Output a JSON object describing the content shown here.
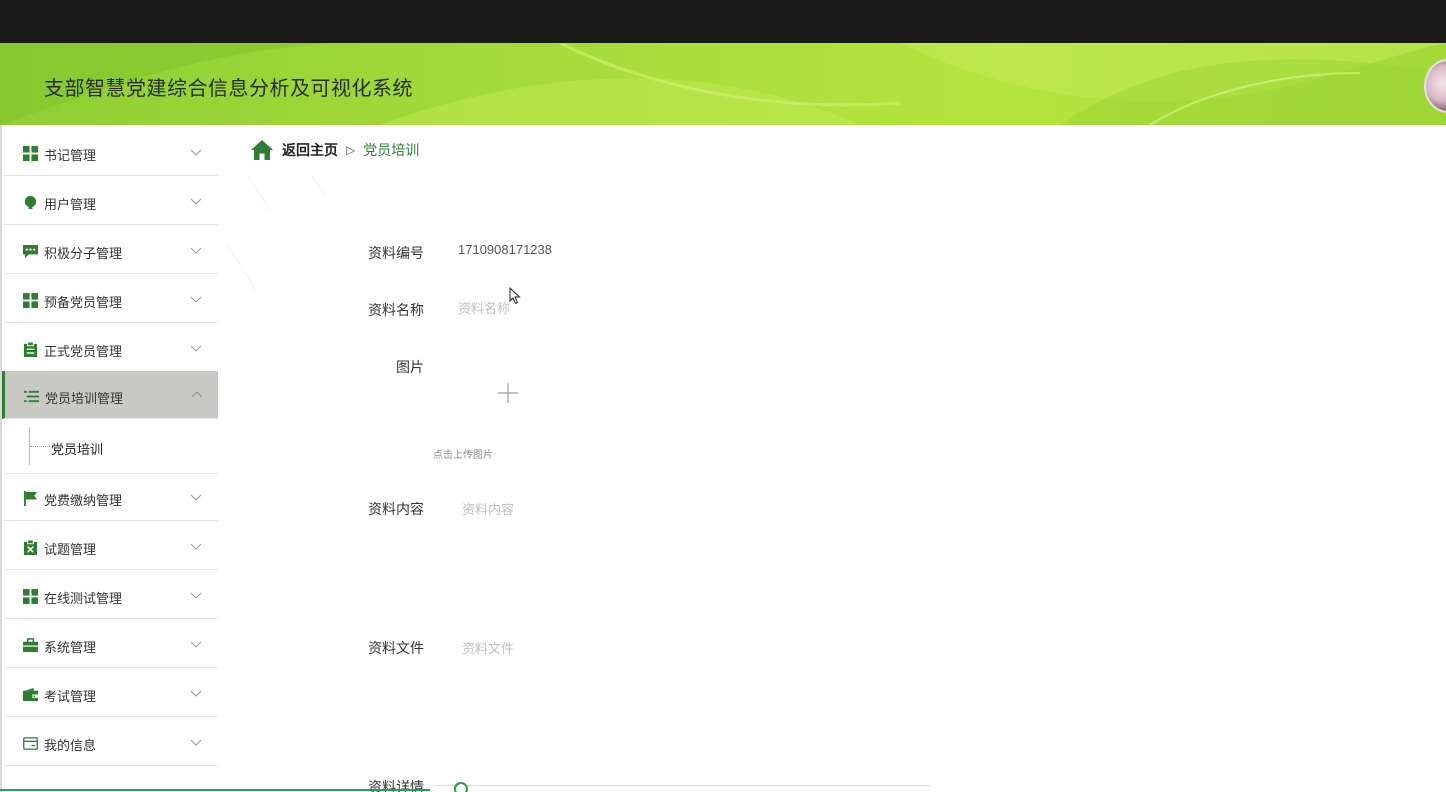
{
  "header": {
    "title": "支部智慧党建综合信息分析及可视化系统"
  },
  "sidebar": {
    "items": [
      {
        "label": "书记管理",
        "icon": "grid-icon"
      },
      {
        "label": "用户管理",
        "icon": "bulb-icon"
      },
      {
        "label": "积极分子管理",
        "icon": "chat-icon"
      },
      {
        "label": "预备党员管理",
        "icon": "grid-icon"
      },
      {
        "label": "正式党员管理",
        "icon": "clipboard-icon"
      },
      {
        "label": "党员培训管理",
        "icon": "list-icon",
        "expanded": true
      },
      {
        "label": "党费缴纳管理",
        "icon": "flag-icon"
      },
      {
        "label": "试题管理",
        "icon": "clipboard-x-icon"
      },
      {
        "label": "在线测试管理",
        "icon": "grid-icon"
      },
      {
        "label": "系统管理",
        "icon": "briefcase-icon"
      },
      {
        "label": "考试管理",
        "icon": "wallet-icon"
      },
      {
        "label": "我的信息",
        "icon": "card-icon"
      }
    ],
    "submenu": {
      "label": "党员培训"
    }
  },
  "breadcrumb": {
    "home": "返回主页",
    "separator": "▷",
    "current": "党员培训"
  },
  "form": {
    "code_label": "资料编号",
    "code_value": "1710908171238",
    "name_label": "资料名称",
    "name_placeholder": "资料名称",
    "image_label": "图片",
    "upload_hint": "点击上传图片",
    "content_label": "资料内容",
    "content_placeholder": "资料内容",
    "file_label": "资料文件",
    "file_placeholder": "资料文件",
    "detail_label": "资料详情"
  },
  "colors": {
    "accent": "#2e7d32",
    "header_green": "#a6dc3a",
    "topbar": "#1a1a1a",
    "active_menu": "#c8c8c4"
  }
}
